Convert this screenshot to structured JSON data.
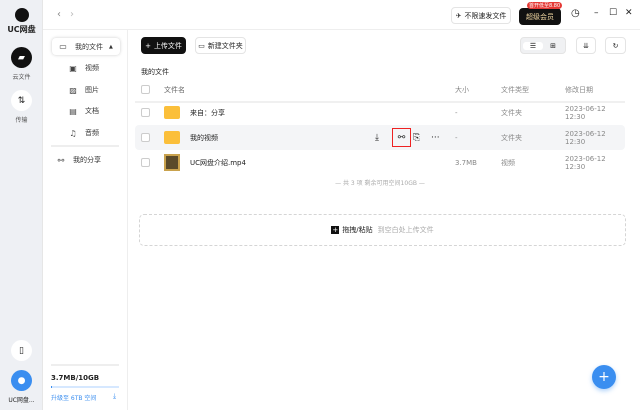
{
  "app": {
    "logo": "UC网盘"
  },
  "rail": {
    "cloud": "云文件",
    "transfer": "传输",
    "user": "UC网盘..."
  },
  "topbar": {
    "speed_btn": "不限速发文件",
    "vip_btn": "超级会员",
    "vip_badge": "首开低至8.80"
  },
  "sidebar": {
    "my_files": "我的文件",
    "items": [
      {
        "label": "视频"
      },
      {
        "label": "图片"
      },
      {
        "label": "文档"
      },
      {
        "label": "音频"
      }
    ],
    "my_share": "我的分享",
    "storage": "3.7MB/10GB",
    "storage_fraction": 0.0004,
    "upgrade": "升级至 6TB 空间"
  },
  "toolbar": {
    "upload": "上传文件",
    "new_folder": "新建文件夹"
  },
  "main": {
    "breadcrumb": "我的文件",
    "columns": {
      "name": "文件名",
      "size": "大小",
      "type": "文件类型",
      "date": "修改日期"
    },
    "rows": [
      {
        "name": "来自：分享",
        "size": "-",
        "type": "文件夹",
        "date": "2023-06-12 12:30"
      },
      {
        "name": "我的视频",
        "size": "-",
        "type": "文件夹",
        "date": "2023-06-12 12:30"
      },
      {
        "name": "UC网盘介绍.mp4",
        "size": "3.7MB",
        "type": "视频",
        "date": "2023-06-12 12:30"
      }
    ],
    "summary": "— 共 3 项 剩余可用空间10GB —",
    "drop_bold": "拖拽/粘贴",
    "drop_hint": "到空白处上传文件"
  }
}
